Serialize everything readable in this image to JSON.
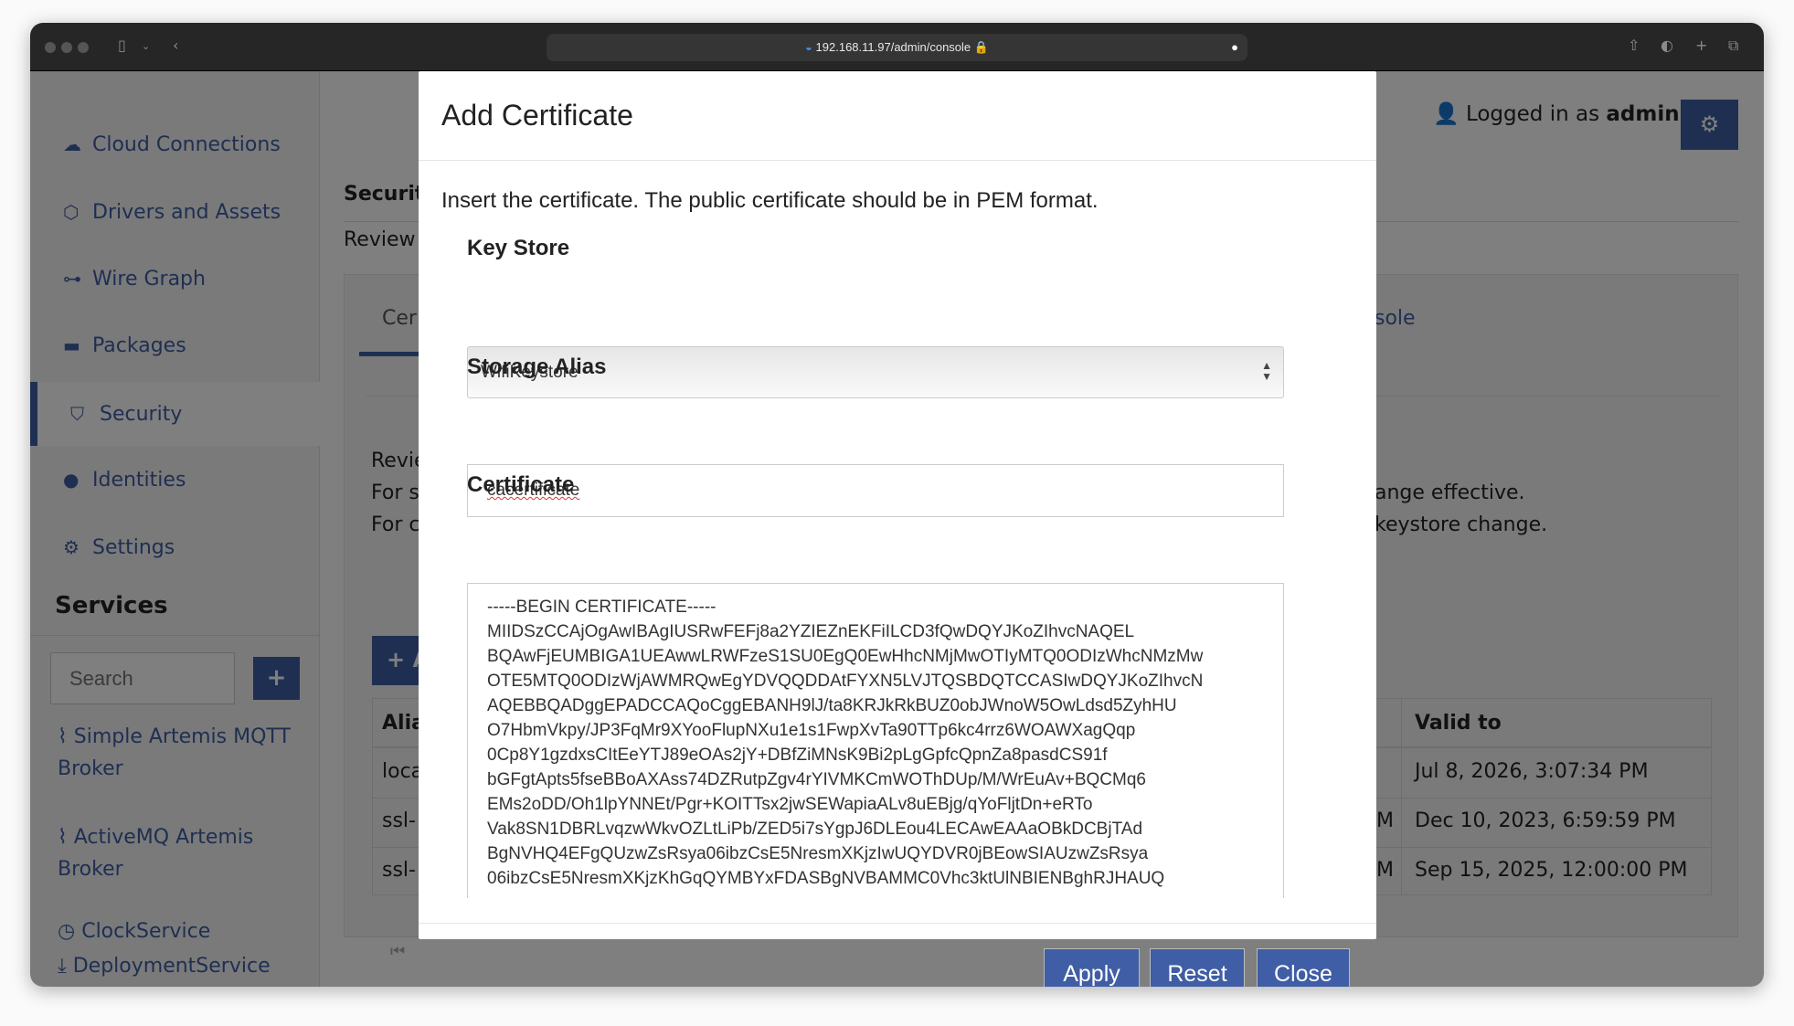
{
  "browser": {
    "url": "192.168.11.97/admin/console"
  },
  "sidebar": {
    "items": [
      {
        "label": "Cloud Connections",
        "icon": "cloud-icon"
      },
      {
        "label": "Drivers and Assets",
        "icon": "cube-icon"
      },
      {
        "label": "Wire Graph",
        "icon": "sitemap-icon"
      },
      {
        "label": "Packages",
        "icon": "briefcase-icon"
      },
      {
        "label": "Security",
        "icon": "shield-icon"
      },
      {
        "label": "Identities",
        "icon": "user-icon"
      },
      {
        "label": "Settings",
        "icon": "gear-icon"
      }
    ],
    "services_title": "Services",
    "search_placeholder": "Search",
    "add_label": "+",
    "services": [
      "Simple Artemis MQTT Broker",
      "ActiveMQ Artemis Broker",
      "ClockService",
      "DeploymentService"
    ]
  },
  "header": {
    "logged_in_prefix": "Logged in as",
    "user": "admin"
  },
  "page": {
    "title_fragment": "Security",
    "subtitle_fragment": "Review",
    "tab_fragment": "Cer",
    "tab2_fragment": "sole",
    "text_left": [
      "Revie",
      "For s",
      "For c"
    ],
    "text_right": [
      "ange effective.",
      "keystore change."
    ],
    "add_fragment": "+ A",
    "table": {
      "alias_header_fragment": "Alia",
      "valid_header": "Valid to",
      "alias_fragments": [
        "loca",
        "ssl-",
        "ssl-"
      ],
      "mid_fragments": [
        "",
        "M",
        "M"
      ],
      "valid_to": [
        "Jul 8, 2026, 3:07:34 PM",
        "Dec 10, 2023, 6:59:59 PM",
        "Sep 15, 2025, 12:00:00 PM"
      ]
    }
  },
  "modal": {
    "title": "Add Certificate",
    "description": "Insert the certificate. The public certificate should be in PEM format.",
    "keystore_label": "Key Store",
    "keystore_value": "WifiKeystore",
    "alias_label": "Storage Alias",
    "alias_value": "cacertificate",
    "certificate_label": "Certificate",
    "certificate_value": "-----BEGIN CERTIFICATE-----\nMIIDSzCCAjOgAwIBAgIUSRwFEFj8a2YZIEZnEKFiILCD3fQwDQYJKoZIhvcNAQEL\nBQAwFjEUMBIGA1UEAwwLRWFzeS1SU0EgQ0EwHhcNMjMwOTIyMTQ0ODIzWhcNMzMw\nOTE5MTQ0ODIzWjAWMRQwEgYDVQQDDAtFYXN5LVJTQSBDQTCCASIwDQYJKoZIhvcN\nAQEBBQADggEPADCCAQoCggEBANH9lJ/ta8KRJkRkBUZ0obJWnoW5OwLdsd5ZyhHU\nO7HbmVkpy/JP3FqMr9XYooFlupNXu1e1s1FwpXvTa90TTp6kc4rrz6WOAWXagQqp\n0Cp8Y1gzdxsCItEeYTJ89eOAs2jY+DBfZiMNsK9Bi2pLgGpfcQpnZa8pasdCS91f\nbGFgtApts5fseBBoAXAss74DZRutpZgv4rYIVMKCmWOThDUp/M/WrEuAv+BQCMq6\nEMs2oDD/Oh1lpYNNEt/Pgr+KOITTsx2jwSEWapiaALv8uEBjg/qYoFljtDn+eRTo\nVak8SN1DBRLvqzwWkvOZLtLiPb/ZED5i7sYgpJ6DLEou4LECAwEAAaOBkDCBjTAd\nBgNVHQ4EFgQUzwZsRsya06ibzCsE5NresmXKjzIwUQYDVR0jBEowSIAUzwZsRsya\n06ibzCsE5NresmXKjzKhGqQYMBYxFDASBgNVBAMMC0Vhc3ktUlNBIENBghRJHAUQ",
    "buttons": {
      "apply": "Apply",
      "reset": "Reset",
      "close": "Close"
    }
  },
  "colors": {
    "accent": "#3f5ea5",
    "titlebar": "#262626"
  }
}
